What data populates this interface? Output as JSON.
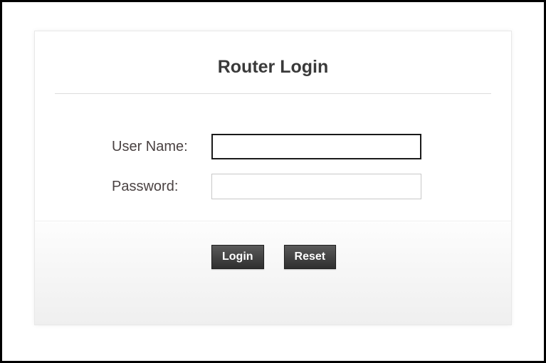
{
  "page": {
    "title": "Router Login"
  },
  "form": {
    "username_label": "User Name:",
    "username_value": "",
    "password_label": "Password:",
    "password_value": ""
  },
  "buttons": {
    "login": "Login",
    "reset": "Reset"
  }
}
